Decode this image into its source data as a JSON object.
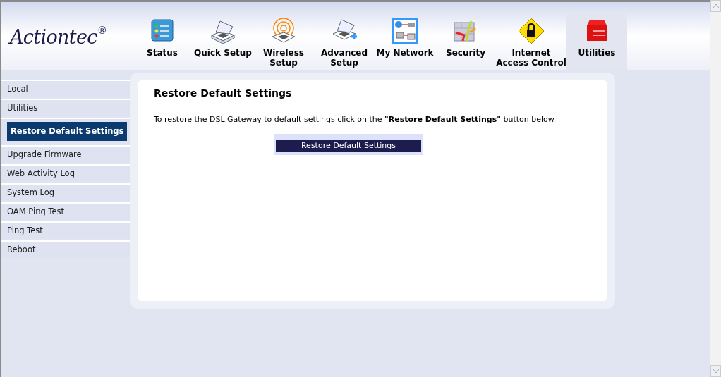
{
  "logo": {
    "text": "Actiontec",
    "mark": "®"
  },
  "nav": [
    {
      "label": "Status",
      "selected": false
    },
    {
      "label": "Quick Setup",
      "selected": false
    },
    {
      "label": "Wireless Setup",
      "selected": false
    },
    {
      "label": "Advanced Setup",
      "selected": false
    },
    {
      "label": "My Network",
      "selected": false
    },
    {
      "label": "Security",
      "selected": false
    },
    {
      "label": "Internet Access Control",
      "selected": false
    },
    {
      "label": "Utilities",
      "selected": true
    }
  ],
  "sidebar": {
    "items": [
      {
        "label": "Local",
        "selected": false
      },
      {
        "label": "Utilities",
        "selected": false
      },
      {
        "label": "Restore Default Settings",
        "selected": true
      },
      {
        "label": "Upgrade Firmware",
        "selected": false
      },
      {
        "label": "Web Activity Log",
        "selected": false
      },
      {
        "label": "System Log",
        "selected": false
      },
      {
        "label": "OAM Ping Test",
        "selected": false
      },
      {
        "label": "Ping Test",
        "selected": false
      },
      {
        "label": "Reboot",
        "selected": false
      }
    ]
  },
  "content": {
    "title": "Restore Default Settings",
    "text": "To restore the DSL Gateway to default settings click on the **\"Restore Default Settings\"** button below.",
    "button": "Restore Default Settings"
  }
}
